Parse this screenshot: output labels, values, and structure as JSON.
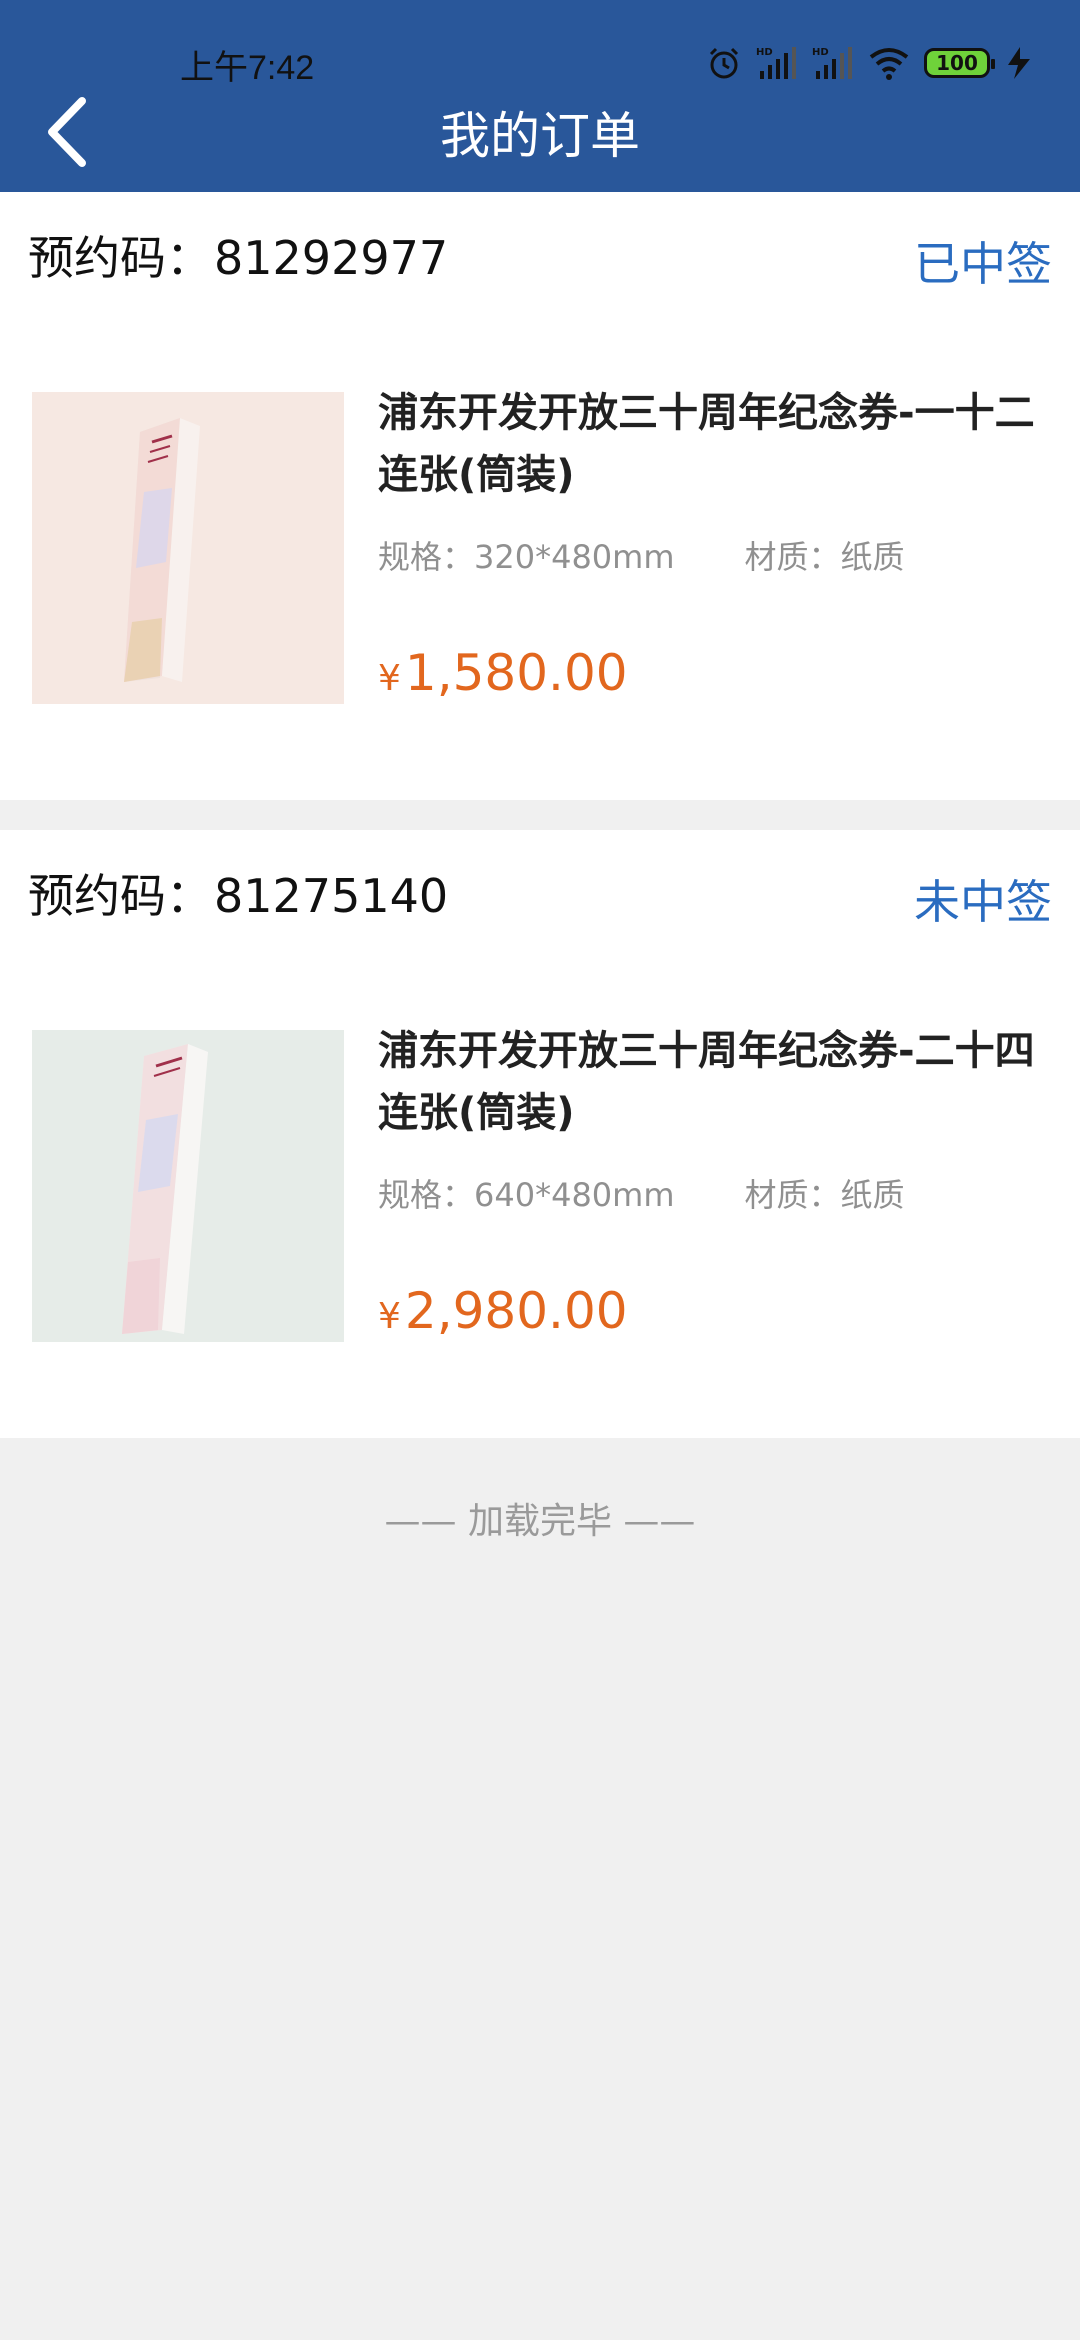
{
  "status_bar": {
    "time": "上午7:42",
    "battery": "100",
    "icons": [
      "alarm-icon",
      "signal-hd-icon",
      "signal-hd-icon",
      "wifi-icon",
      "battery-icon",
      "charging-icon"
    ]
  },
  "nav": {
    "title": "我的订单",
    "back_icon": "back-chevron-icon"
  },
  "orders": [
    {
      "code_label": "预约码：",
      "code": "81292977",
      "status": "已中签",
      "title": "浦东开发开放三十周年纪念券-一十二连张(筒装)",
      "spec": "规格：320*480mm",
      "material": "材质：纸质",
      "currency": "¥",
      "price": "1,580.00"
    },
    {
      "code_label": "预约码：",
      "code": "81275140",
      "status": "未中签",
      "title": "浦东开发开放三十周年纪念券-二十四连张(筒装)",
      "spec": "规格：640*480mm",
      "material": "材质：纸质",
      "currency": "¥",
      "price": "2,980.00"
    }
  ],
  "footer": "—— 加载完毕 ——",
  "colors": {
    "header_bg": "#29579a",
    "status_link": "#2a6cc0",
    "price": "#e2671e"
  }
}
